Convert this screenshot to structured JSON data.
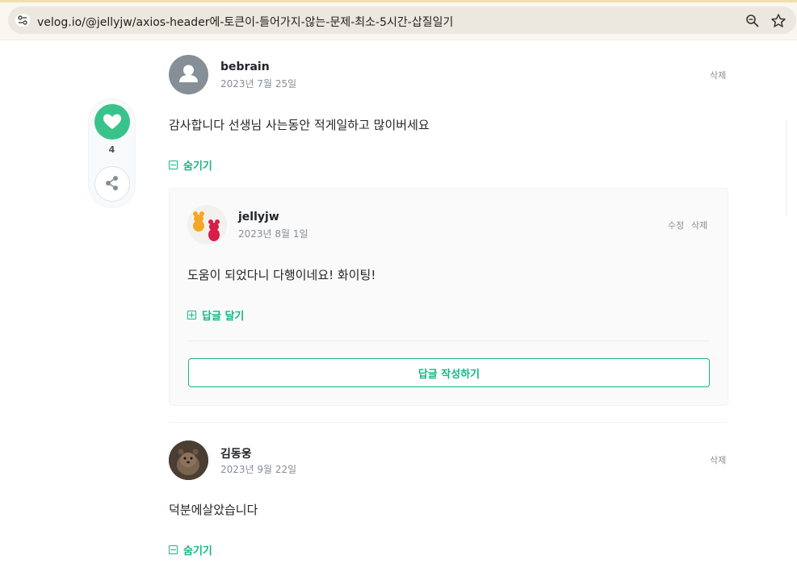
{
  "browser": {
    "url": "velog.io/@jellyjw/axios-header에-토큰이-들어가지-않는-문제-최소-5시간-삽질일기",
    "site_icon": "tune-icon",
    "actions": [
      "zoom-icon",
      "bookmark-star-icon"
    ]
  },
  "sidebar": {
    "like_count": "4",
    "like_icon": "heart-icon",
    "share_icon": "share-icon",
    "accent_color": "#3ac28c"
  },
  "comments": [
    {
      "author": "bebrain",
      "date": "2023년 7월 25일",
      "delete_label": "삭제",
      "text": "감사합니다 선생님 사는동안 적게일하고 많이버세요",
      "toggle_label": "숨기기",
      "reply": {
        "author": "jellyjw",
        "date": "2023년 8월 1일",
        "edit_label": "수정",
        "delete_label": "삭제",
        "text": "도움이 되었다니 다행이네요! 화이팅!",
        "reply_toggle_label": "답글 달기",
        "write_button_label": "답글 작성하기"
      }
    },
    {
      "author": "김동웅",
      "date": "2023년 9월 22일",
      "delete_label": "삭제",
      "text": "덕분에살았습니다",
      "toggle_label": "숨기기"
    }
  ]
}
